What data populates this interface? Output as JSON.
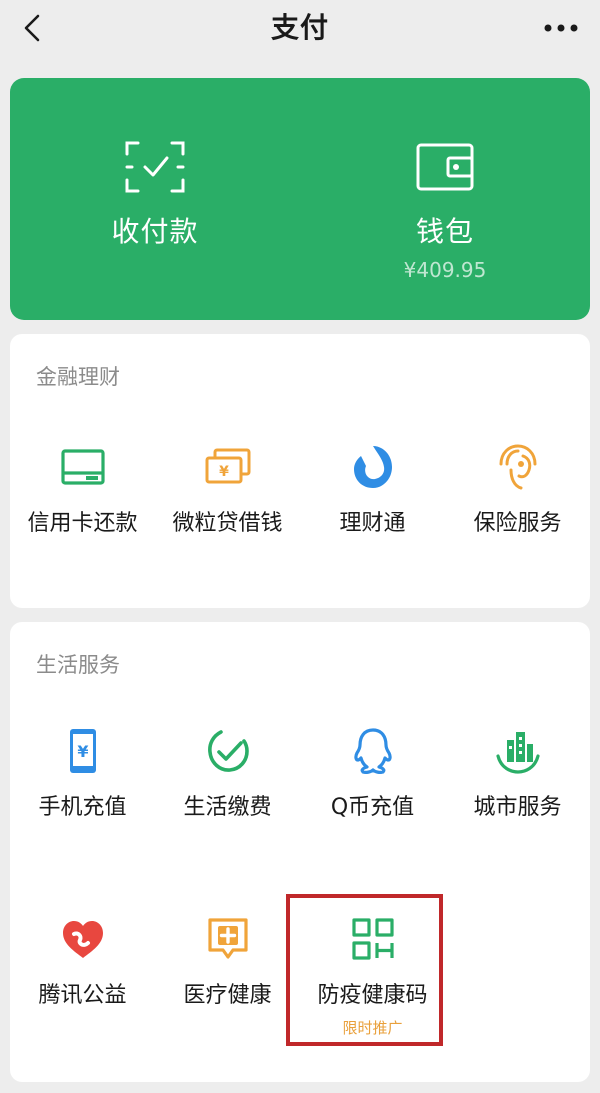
{
  "nav": {
    "title": "支付",
    "back_icon": "chevron-left-icon",
    "more_icon": "more-dots-icon"
  },
  "banner": {
    "background_color": "#2aae67",
    "items": [
      {
        "label": "收付款",
        "icon": "scan-check-icon"
      },
      {
        "label": "钱包",
        "sub": "¥409.95",
        "icon": "wallet-icon"
      }
    ]
  },
  "finance": {
    "title": "金融理财",
    "items": [
      {
        "label": "信用卡还款",
        "icon": "credit-card-icon",
        "color": "#2aae67"
      },
      {
        "label": "微粒贷借钱",
        "icon": "cash-yuan-icon",
        "color": "#f0a43a"
      },
      {
        "label": "理财通",
        "icon": "wealth-drop-icon",
        "color": "#2f8de4"
      },
      {
        "label": "保险服务",
        "icon": "umbrella-person-icon",
        "color": "#f0a43a"
      }
    ]
  },
  "life": {
    "title": "生活服务",
    "items": [
      {
        "label": "手机充值",
        "icon": "phone-yuan-icon",
        "color": "#2f8de4"
      },
      {
        "label": "生活缴费",
        "icon": "check-circle-icon",
        "color": "#2aae67"
      },
      {
        "label": "Q币充值",
        "icon": "qq-penguin-icon",
        "color": "#2f8de4"
      },
      {
        "label": "城市服务",
        "icon": "city-buildings-icon",
        "color": "#2aae67"
      },
      {
        "label": "腾讯公益",
        "icon": "charity-heart-icon",
        "color": "#e8473f"
      },
      {
        "label": "医疗健康",
        "icon": "medical-chat-icon",
        "color": "#f0a43a"
      },
      {
        "label": "防疫健康码",
        "badge": "限时推广",
        "icon": "health-code-icon",
        "color": "#2aae67"
      }
    ]
  }
}
